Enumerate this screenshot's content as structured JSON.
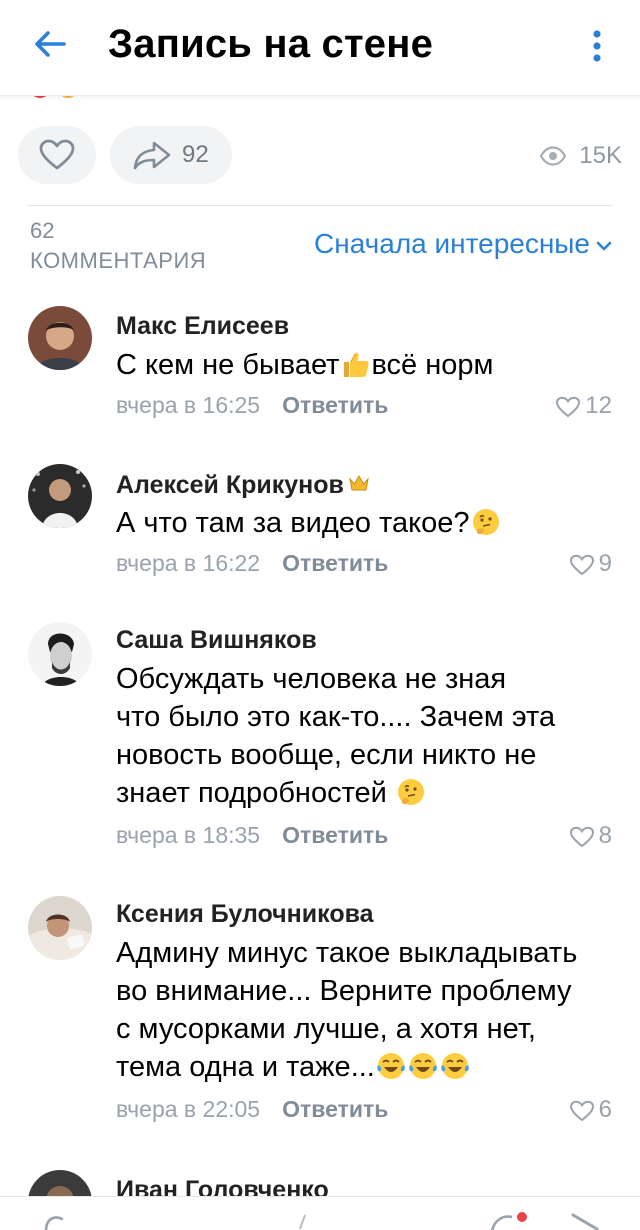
{
  "header": {
    "title": "Запись на стене",
    "back_icon": "back-arrow-icon",
    "menu_icon": "more-vertical-icon",
    "accent_color": "#2a80d8"
  },
  "actions": {
    "like_icon": "heart-outline-icon",
    "share_icon": "share-arrow-icon",
    "share_count": "92",
    "views_icon": "eye-icon",
    "views_count": "15K"
  },
  "comments_header": {
    "count": "62",
    "word": "КОММЕНТАРИЯ",
    "sort_label": "Сначала интересные"
  },
  "comments": [
    {
      "author": "Макс Елисеев",
      "text": "С кем не бывает",
      "text_after": "всё норм",
      "emoji": "thumbs-up",
      "time": "вчера в 16:25",
      "reply": "Ответить",
      "likes": "12"
    },
    {
      "author": "Алексей Крикунов",
      "badge": "crown",
      "text": "А что там за видео такое?",
      "emoji": "thinking-face",
      "time": "вчера в 16:22",
      "reply": "Ответить",
      "likes": "9"
    },
    {
      "author": "Саша Вишняков",
      "text_lines": [
        "Обсуждать человека не зная",
        "что было это как-то.... Зачем эта",
        "новость вообще, если никто не",
        "знает подробностей "
      ],
      "emoji": "thinking-face",
      "time": "вчера в 18:35",
      "reply": "Ответить",
      "likes": "8"
    },
    {
      "author": "Ксения Булочникова",
      "text_lines": [
        "Админу минус такое выкладывать",
        "во внимание... Верните проблему",
        "с мусорками лучше, а хотя нет,",
        "тема одна и таже..."
      ],
      "emoji": "tears-of-joy x3",
      "time": "вчера в 22:05",
      "reply": "Ответить",
      "likes": "6"
    },
    {
      "author": "Иван Головченко"
    }
  ]
}
